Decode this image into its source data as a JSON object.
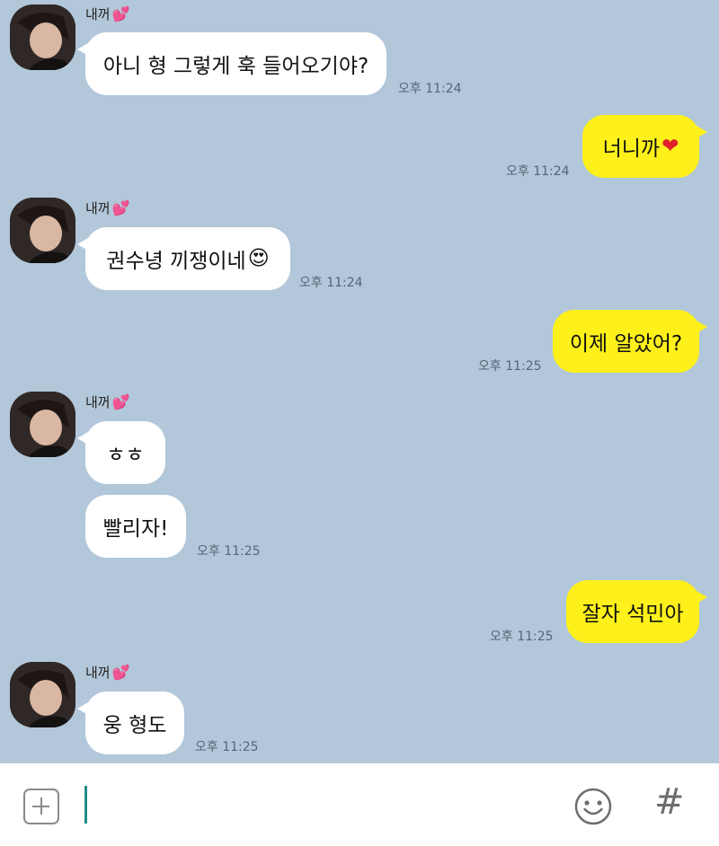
{
  "sender_name": "내꺼",
  "sender_heart": "💕",
  "messages": [
    {
      "from": "other",
      "text": "아니 형 그렇게 훅 들어오기야?",
      "time": "오후 11:24",
      "show_sender": true
    },
    {
      "from": "me",
      "text": "너니까",
      "emoji": "❤",
      "time": "오후 11:24"
    },
    {
      "from": "other",
      "text": "권수녕 끼쟁이네",
      "emoji": "😍",
      "time": "오후 11:24",
      "show_sender": true
    },
    {
      "from": "me",
      "text": "이제 알았어?",
      "time": "오후 11:25"
    },
    {
      "from": "other",
      "text": "ㅎㅎ",
      "time": "",
      "show_sender": true
    },
    {
      "from": "other",
      "text": "빨리자!",
      "time": "오후 11:25"
    },
    {
      "from": "me",
      "text": "잘자 석민아",
      "time": "오후 11:25"
    },
    {
      "from": "other",
      "text": "웅 형도",
      "time": "오후 11:25",
      "show_sender": true
    }
  ],
  "input_bar": {
    "value": "",
    "attach_icon": "plus-square-icon",
    "emoticon_icon": "smiley-icon",
    "hashtag_icon": "hash-icon",
    "hashtag_label": "#"
  },
  "colors": {
    "chat_background": "#b2c7d9",
    "my_bubble": "#fef01b",
    "their_bubble": "#ffffff",
    "caret": "#1e8c86"
  }
}
